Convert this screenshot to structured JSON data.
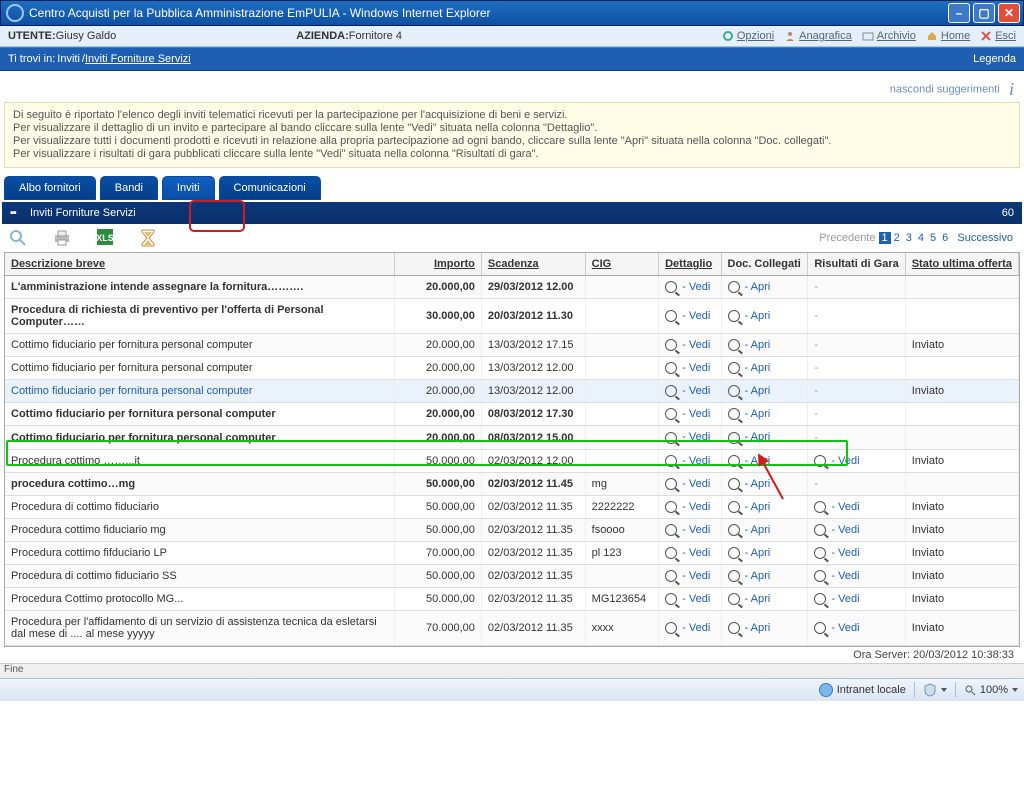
{
  "window_title": "Centro Acquisti per la Pubblica Amministrazione EmPULIA - Windows Internet Explorer",
  "header": {
    "utente_label": "UTENTE: ",
    "utente_value": "Giusy Galdo",
    "azienda_label": "AZIENDA: ",
    "azienda_value": "Fornitore 4",
    "links": {
      "opzioni": "Opzioni",
      "anagrafica": "Anagrafica",
      "archivio": "Archivio",
      "home": "Home",
      "esci": "Esci"
    }
  },
  "breadcrumb": {
    "prefix": "Ti trovi in:",
    "path": "Inviti",
    "leaf": "Inviti Forniture Servizi",
    "legenda": "Legenda"
  },
  "tip": {
    "text": "nascondi suggerimenti",
    "icon": "i"
  },
  "infobox": {
    "l1": "Di seguito è riportato l'elenco degli inviti telematici ricevuti per la partecipazione per l'acquisizione di beni e servizi.",
    "l2": "Per visualizzare il dettaglio di un invito e partecipare al bando cliccare sulla lente \"Vedi\" situata nella colonna \"Dettaglio\".",
    "l3": "Per visualizzare tutti i documenti prodotti e ricevuti in relazione alla propria partecipazione ad ogni bando, cliccare sulla lente \"Apri\" situata nella colonna \"Doc. collegati\".",
    "l4": "Per visualizzare i risultati di gara pubblicati cliccare sulla lente \"Vedi\" situata nella colonna \"Risultati di gara\"."
  },
  "tabs": {
    "albo": "Albo fornitori",
    "bandi": "Bandi",
    "inviti": "Inviti",
    "comunicazioni": "Comunicazioni"
  },
  "section": {
    "title": "Inviti Forniture Servizi",
    "count": "60"
  },
  "pager": {
    "prev": "Precedente",
    "pages": [
      "1",
      "2",
      "3",
      "4",
      "5",
      "6"
    ],
    "current": "1",
    "next": "Successivo"
  },
  "columns": {
    "descr": "Descrizione breve",
    "importo": "Importo",
    "scadenza": "Scadenza",
    "cig": "CIG",
    "dettaglio": "Dettaglio",
    "doc": "Doc. Collegati",
    "risultati": "Risultati di Gara",
    "stato": "Stato ultima offerta"
  },
  "actions": {
    "vedi": " - Vedi",
    "apri": " - Apri"
  },
  "rows": [
    {
      "descr": "L'amministrazione intende assegnare la fornitura……….",
      "importo": "20.000,00",
      "scad": "29/03/2012 12.00",
      "cig": "",
      "det": true,
      "apri": true,
      "ris": "-",
      "stato": "",
      "bold": true
    },
    {
      "descr": "Procedura di richiesta di preventivo per l'offerta di Personal Computer……",
      "importo": "30.000,00",
      "scad": "20/03/2012 11.30",
      "cig": "",
      "det": true,
      "apri": true,
      "ris": "-",
      "stato": "",
      "bold": true
    },
    {
      "descr": "Cottimo fiduciario per fornitura personal computer",
      "importo": "20.000,00",
      "scad": "13/03/2012 17.15",
      "cig": "",
      "det": true,
      "apri": true,
      "ris": "-",
      "stato": "Inviato"
    },
    {
      "descr": "Cottimo fiduciario per fornitura personal computer",
      "importo": "20.000,00",
      "scad": "13/03/2012 12.00",
      "cig": "",
      "det": true,
      "apri": true,
      "ris": "-",
      "stato": ""
    },
    {
      "descr": "Cottimo fiduciario per fornitura personal computer",
      "importo": "20.000,00",
      "scad": "13/03/2012 12.00",
      "cig": "",
      "det": true,
      "apri": true,
      "ris": "-",
      "stato": "Inviato",
      "bluerow": true,
      "link": true
    },
    {
      "descr": "Cottimo fiduciario per fornitura personal computer",
      "importo": "20.000,00",
      "scad": "08/03/2012 17.30",
      "cig": "",
      "det": true,
      "apri": true,
      "ris": "-",
      "stato": "",
      "bold": true
    },
    {
      "descr": "Cottimo fiduciario per fornitura personal computer",
      "importo": "20.000,00",
      "scad": "08/03/2012 15.00",
      "cig": "",
      "det": true,
      "apri": true,
      "ris": "-",
      "stato": "",
      "bold": true
    },
    {
      "descr": "Procedura cottimo ……...it",
      "importo": "50.000,00",
      "scad": "02/03/2012 12.00",
      "cig": "",
      "det": true,
      "apri": true,
      "ris": "Vedi",
      "stato": "Inviato"
    },
    {
      "descr": "procedura cottimo…mg",
      "importo": "50.000,00",
      "scad": "02/03/2012 11.45",
      "cig": "mg",
      "det": true,
      "apri": true,
      "ris": "-",
      "stato": "",
      "bold": true
    },
    {
      "descr": "Procedura di cottimo fiduciario",
      "importo": "50.000,00",
      "scad": "02/03/2012 11.35",
      "cig": "2222222",
      "det": true,
      "apri": true,
      "ris": "Vedi",
      "stato": "Inviato"
    },
    {
      "descr": "Procedura cottimo fiduciario mg",
      "importo": "50.000,00",
      "scad": "02/03/2012 11.35",
      "cig": "fsoooo",
      "det": true,
      "apri": true,
      "ris": "Vedi",
      "stato": "Inviato"
    },
    {
      "descr": "Procedura cottimo fifduciario LP",
      "importo": "70.000,00",
      "scad": "02/03/2012 11.35",
      "cig": "pl 123",
      "det": true,
      "apri": true,
      "ris": "Vedi",
      "stato": "Inviato"
    },
    {
      "descr": "Procedura di cottimo fiduciario SS",
      "importo": "50.000,00",
      "scad": "02/03/2012 11.35",
      "cig": "",
      "det": true,
      "apri": true,
      "ris": "Vedi",
      "stato": "Inviato"
    },
    {
      "descr": "Procedura Cottimo protocollo MG...",
      "importo": "50.000,00",
      "scad": "02/03/2012 11.35",
      "cig": "MG123654",
      "det": true,
      "apri": true,
      "ris": "Vedi",
      "stato": "Inviato"
    },
    {
      "descr": "Procedura per l'affidamento di un servizio di assistenza tecnica da esletarsi dal mese di .... al mese yyyyy",
      "importo": "70.000,00",
      "scad": "02/03/2012 11.35",
      "cig": "xxxx",
      "det": true,
      "apri": true,
      "ris": "Vedi",
      "stato": "Inviato"
    }
  ],
  "srvtime": "Ora Server: 20/03/2012 10:38:33",
  "fine": "Fine",
  "status": {
    "zone": "Intranet locale",
    "zoom": "100%"
  }
}
